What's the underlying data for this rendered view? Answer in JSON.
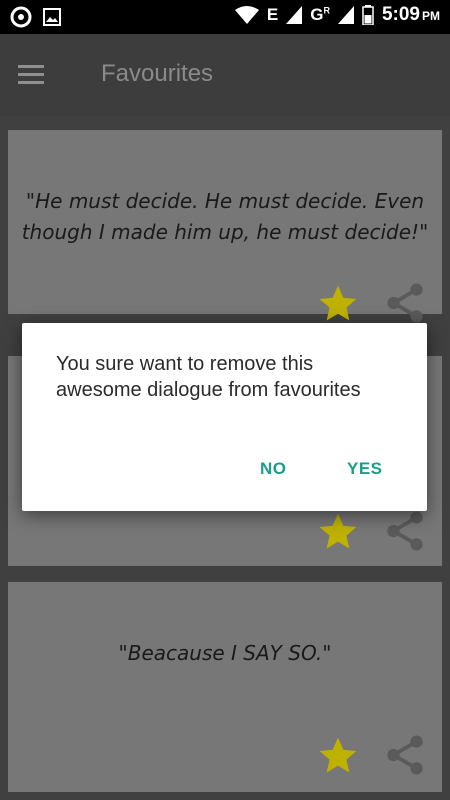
{
  "status_bar": {
    "time": "5:09",
    "ampm": "PM",
    "network_1": "E",
    "network_2": "G",
    "network_2_sup": "R"
  },
  "app_bar": {
    "title": "Favourites",
    "menu_icon": "hamburger-menu-icon"
  },
  "cards": [
    {
      "quote": "\"He must decide. He must decide. Even though I made him up, he must decide!\"",
      "favourite": true
    },
    {
      "quote": "",
      "favourite": true
    },
    {
      "quote": "\"Beacause I SAY SO.\"",
      "favourite": true
    }
  ],
  "dialog": {
    "message": "You sure want to remove this awesome dialogue from favourites",
    "no_label": "NO",
    "yes_label": "YES"
  },
  "colors": {
    "accent": "#1a9e8c",
    "star": "#bfb100",
    "appbar": "#3d3d3d",
    "card": "#777777"
  }
}
